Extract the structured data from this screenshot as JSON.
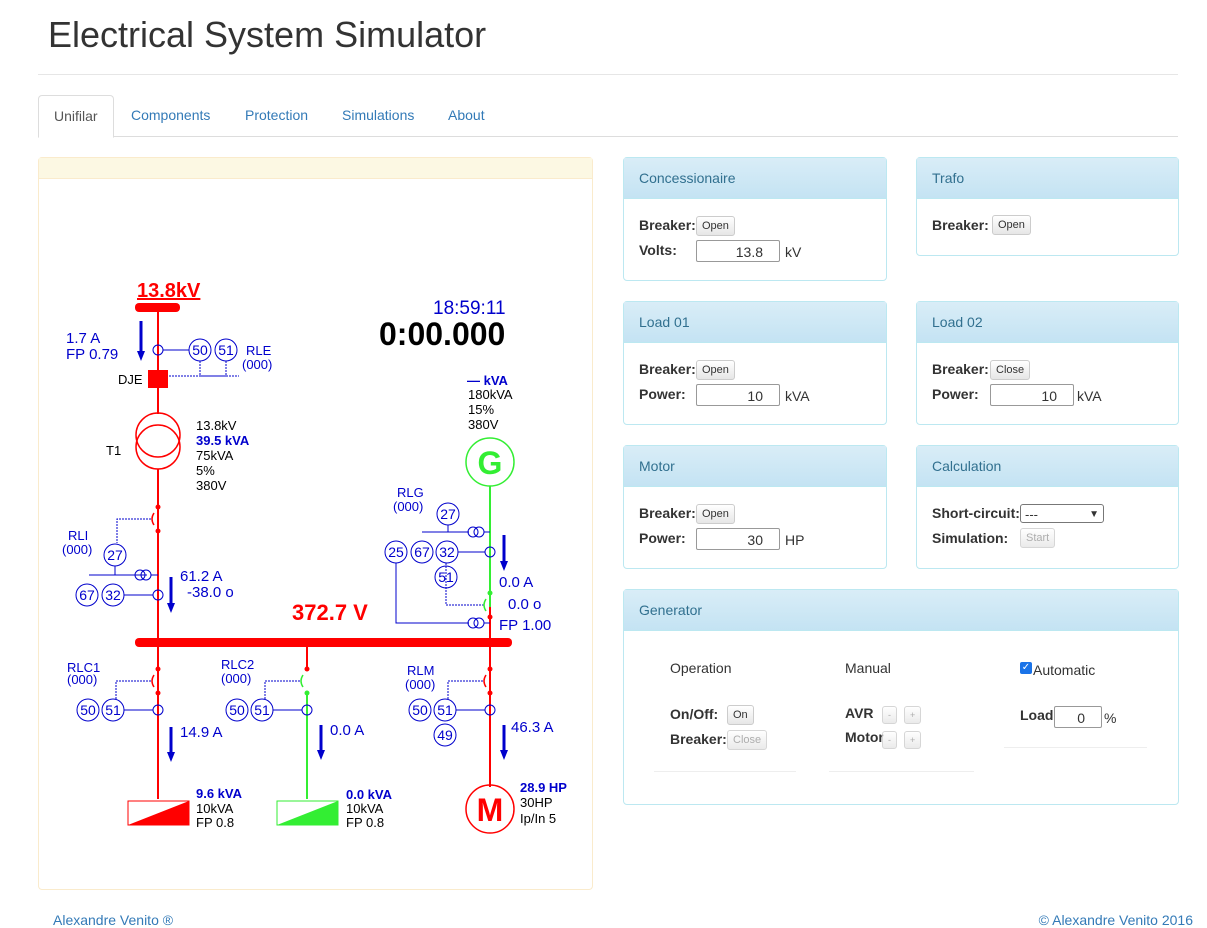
{
  "app": {
    "title": "Electrical System Simulator"
  },
  "tabs": [
    {
      "label": "Unifilar"
    },
    {
      "label": "Components"
    },
    {
      "label": "Protection"
    },
    {
      "label": "Simulations"
    },
    {
      "label": "About"
    }
  ],
  "diagram": {
    "source_voltage": "13.8kV",
    "source_current": "1.7 A",
    "source_fp": "FP 0.79",
    "relay_50": "50",
    "relay_51": "51",
    "relay_27": "27",
    "relay_67": "67",
    "relay_32": "32",
    "relay_25": "25",
    "relay_49": "49",
    "rle_label": "RLE",
    "rle_code": "(000)",
    "dje_label": "DJE",
    "t1_label": "T1",
    "t1_primary": "13.8kV",
    "t1_power": "39.5 kVA",
    "t1_rating": "75kVA",
    "t1_impedance": "5%",
    "t1_secondary": "380V",
    "rli_label": "RLI",
    "rli_code": "(000)",
    "rli_current": "61.2 A",
    "rli_angle": "-38.0 o",
    "clock": "18:59:11",
    "timer": "0:00.000",
    "gen_power": "— kVA",
    "gen_rating": "180kVA",
    "gen_impedance": "15%",
    "gen_voltage": "380V",
    "gen_symbol": "G",
    "rlg_label": "RLG",
    "rlg_code": "(000)",
    "gen_current": "0.0 A",
    "gen_angle": "0.0 o",
    "gen_fp": "FP 1.00",
    "bus_voltage": "372.7 V",
    "rlc1_label": "RLC1",
    "rlc1_code": "(000)",
    "rlc2_label": "RLC2",
    "rlc2_code": "(000)",
    "rlm_label": "RLM",
    "rlm_code": "(000)",
    "load1_current": "14.9 A",
    "load2_current": "0.0 A",
    "motor_current": "46.3 A",
    "load1_power": "9.6 kVA",
    "load1_rating": "10kVA",
    "load1_fp": "FP 0.8",
    "load2_power": "0.0 kVA",
    "load2_rating": "10kVA",
    "load2_fp": "FP 0.8",
    "motor_power": "28.9 HP",
    "motor_rating": "30HP",
    "motor_ipin": "Ip/In 5",
    "motor_symbol": "M"
  },
  "concessionaire": {
    "title": "Concessionaire",
    "breaker_label": "Breaker:",
    "breaker_btn": "Open",
    "volts_label": "Volts:",
    "volts_value": "13.8",
    "volts_unit": "kV"
  },
  "trafo": {
    "title": "Trafo",
    "breaker_label": "Breaker:",
    "breaker_btn": "Open"
  },
  "load01": {
    "title": "Load 01",
    "breaker_label": "Breaker:",
    "breaker_btn": "Open",
    "power_label": "Power:",
    "power_value": "10",
    "power_unit": "kVA"
  },
  "load02": {
    "title": "Load 02",
    "breaker_label": "Breaker:",
    "breaker_btn": "Close",
    "power_label": "Power:",
    "power_value": "10",
    "power_unit": "kVA"
  },
  "motor": {
    "title": "Motor",
    "breaker_label": "Breaker:",
    "breaker_btn": "Open",
    "power_label": "Power:",
    "power_value": "30",
    "power_unit": "HP"
  },
  "calculation": {
    "title": "Calculation",
    "short_circuit_label": "Short-circuit:",
    "short_circuit_value": "---",
    "simulation_label": "Simulation:",
    "simulation_btn": "Start"
  },
  "generator": {
    "title": "Generator",
    "operation_title": "Operation",
    "onoff_label": "On/Off:",
    "onoff_btn": "On",
    "breaker_label": "Breaker:",
    "breaker_btn": "Close",
    "manual_title": "Manual",
    "avr_label": "AVR",
    "motor_label": "Motor",
    "minus": "-",
    "plus": "+",
    "automatic_label": "Automatic",
    "automatic_checked": true,
    "load_label": "Load",
    "load_value": "0",
    "load_unit": "%"
  },
  "footer": {
    "left": "Alexandre Venito ®",
    "right": "© Alexandre Venito 2016"
  },
  "colors": {
    "energized": "#ff0000",
    "generator": "#33ee33",
    "relay": "#0000cc",
    "accent": "#337ab7"
  }
}
